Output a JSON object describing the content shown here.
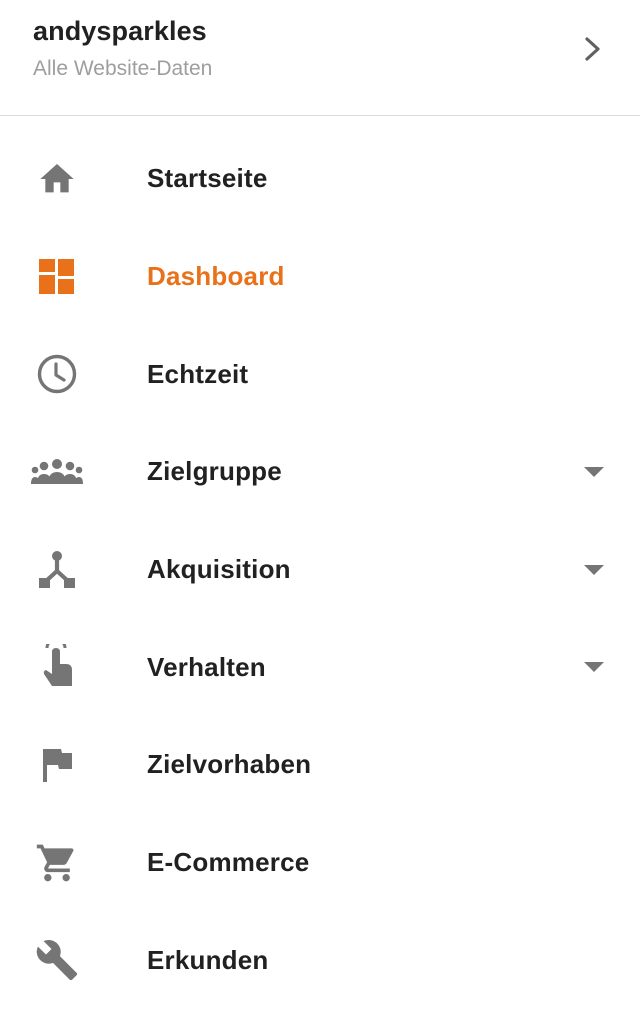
{
  "account": {
    "name": "andysparkles",
    "property": "Alle Website-Daten"
  },
  "colors": {
    "accent": "#e8711a",
    "icon": "#757575",
    "text": "#212121",
    "subtext": "#9e9e9e"
  },
  "menu": [
    {
      "label": "Startseite",
      "icon": "home-icon",
      "expandable": false,
      "active": false
    },
    {
      "label": "Dashboard",
      "icon": "dashboard-icon",
      "expandable": false,
      "active": true
    },
    {
      "label": "Echtzeit",
      "icon": "clock-icon",
      "expandable": false,
      "active": false
    },
    {
      "label": "Zielgruppe",
      "icon": "people-icon",
      "expandable": true,
      "active": false
    },
    {
      "label": "Akquisition",
      "icon": "acquisition-icon",
      "expandable": true,
      "active": false
    },
    {
      "label": "Verhalten",
      "icon": "touch-icon",
      "expandable": true,
      "active": false
    },
    {
      "label": "Zielvorhaben",
      "icon": "flag-icon",
      "expandable": false,
      "active": false
    },
    {
      "label": "E-Commerce",
      "icon": "cart-icon",
      "expandable": false,
      "active": false
    },
    {
      "label": "Erkunden",
      "icon": "wrench-icon",
      "expandable": false,
      "active": false
    }
  ]
}
